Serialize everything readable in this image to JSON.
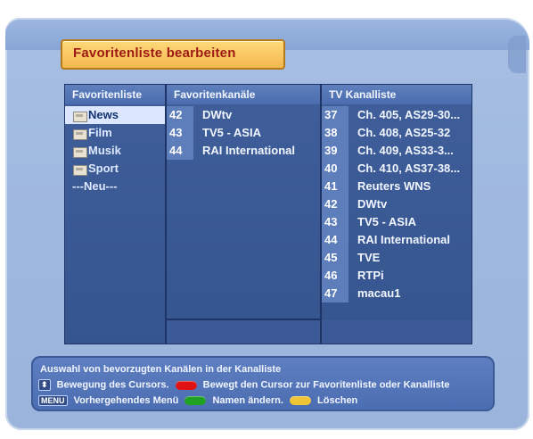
{
  "title": "Favoritenliste bearbeiten",
  "headers": [
    "Favoritenliste",
    "Favoritenkanäle",
    "TV Kanalliste"
  ],
  "favoriten": [
    {
      "label": "News",
      "selected": true,
      "icon": "folder-icon"
    },
    {
      "label": "Film",
      "selected": false,
      "icon": "folder-icon"
    },
    {
      "label": "Musik",
      "selected": false,
      "icon": "folder-icon"
    },
    {
      "label": "Sport",
      "selected": false,
      "icon": "folder-icon"
    },
    {
      "label": "---Neu---",
      "selected": false,
      "icon": null
    }
  ],
  "favoritenkanaele": [
    {
      "num": "42",
      "name": "DWtv"
    },
    {
      "num": "43",
      "name": "TV5 - ASIA"
    },
    {
      "num": "44",
      "name": "RAI International"
    }
  ],
  "tv_kanalliste": [
    {
      "num": "37",
      "name": "Ch. 405, AS29-30..."
    },
    {
      "num": "38",
      "name": "Ch. 408, AS25-32"
    },
    {
      "num": "39",
      "name": "Ch. 409, AS33-3..."
    },
    {
      "num": "40",
      "name": "Ch. 410, AS37-38..."
    },
    {
      "num": "41",
      "name": "Reuters WNS"
    },
    {
      "num": "42",
      "name": "DWtv"
    },
    {
      "num": "43",
      "name": "TV5 - ASIA"
    },
    {
      "num": "44",
      "name": "RAI International"
    },
    {
      "num": "45",
      "name": "TVE"
    },
    {
      "num": "46",
      "name": "RTPi"
    },
    {
      "num": "47",
      "name": "macau1"
    }
  ],
  "help": {
    "line0": "Auswahl von bevorzugten Kanälen in der Kanalliste",
    "line1_a": "Bewegung des Cursors.",
    "line1_b": "Bewegt den Cursor zur Favoritenliste oder Kanalliste",
    "line2_key": "MENU",
    "line2_a": "Vorhergehendes Menü",
    "line2_b": "Namen ändern.",
    "line2_c": "Löschen",
    "colors": {
      "red": "#e11212",
      "green": "#1fa124",
      "yellow": "#f0c437"
    }
  }
}
